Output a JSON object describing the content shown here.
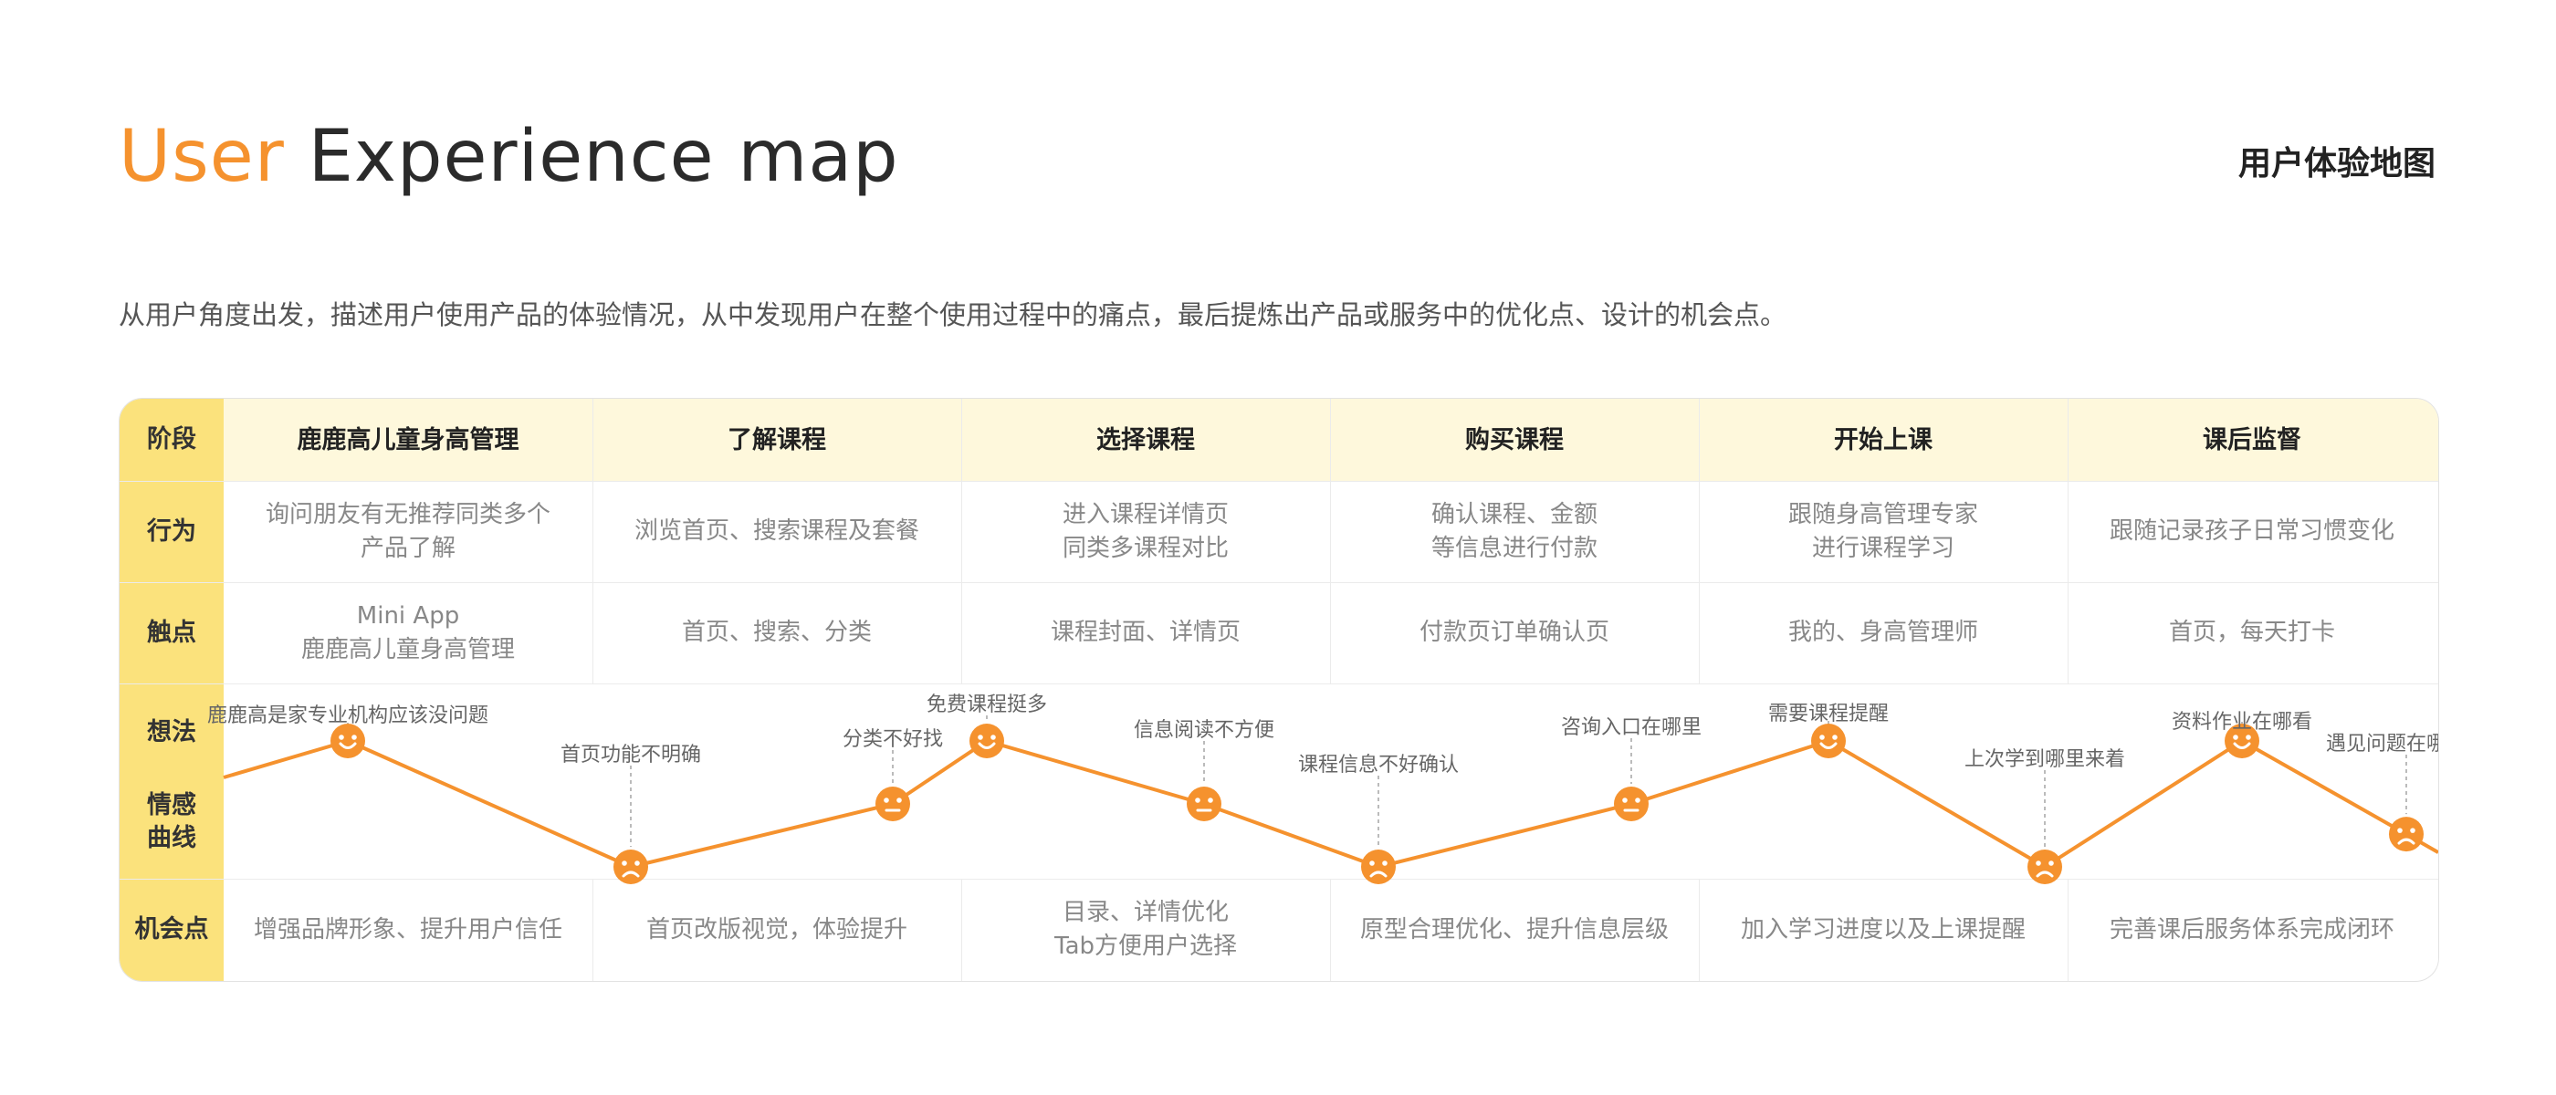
{
  "title": {
    "accent": "User",
    "rest": " Experience map"
  },
  "subtitle_cn": "用户体验地图",
  "description": "从用户角度出发，描述用户使用产品的体验情况，从中发现用户在整个使用过程中的痛点，最后提炼出产品或服务中的优化点、设计的机会点。",
  "row_labels": {
    "stage": "阶段",
    "behavior": "行为",
    "touchpoint": "触点",
    "thought": "想法",
    "emotion": "情感\n曲线",
    "opportunity": "机会点"
  },
  "stages": [
    {
      "name": "鹿鹿高儿童身高管理",
      "behavior": "询问朋友有无推荐同类多个\n产品了解",
      "touchpoint": "Mini App\n鹿鹿高儿童身高管理",
      "opportunity": "增强品牌形象、提升用户信任"
    },
    {
      "name": "了解课程",
      "behavior": "浏览首页、搜索课程及套餐",
      "touchpoint": "首页、搜索、分类",
      "opportunity": "首页改版视觉，体验提升"
    },
    {
      "name": "选择课程",
      "behavior": "进入课程详情页\n同类多课程对比",
      "touchpoint": "课程封面、详情页",
      "opportunity": "目录、详情优化\nTab方便用户选择"
    },
    {
      "name": "购买课程",
      "behavior": "确认课程、金额\n等信息进行付款",
      "touchpoint": "付款页订单确认页",
      "opportunity": "原型合理优化、提升信息层级"
    },
    {
      "name": "开始上课",
      "behavior": "跟随身高管理专家\n进行课程学习",
      "touchpoint": "我的、身高管理师",
      "opportunity": "加入学习进度以及上课提醒"
    },
    {
      "name": "课后监督",
      "behavior": "跟随记录孩子日常习惯变化",
      "touchpoint": "首页，每天打卡",
      "opportunity": "完善课后服务体系完成闭环"
    }
  ],
  "emotion_points": [
    {
      "thought": "鹿鹿高是家专业机构应该没问题",
      "mood": "happy",
      "level": 0.77
    },
    {
      "thought": "首页功能不明确",
      "mood": "sad",
      "level": 0.27
    },
    {
      "thought": "分类不好找",
      "mood": "neutral",
      "level": 0.52
    },
    {
      "thought": "免费课程挺多",
      "mood": "happy",
      "level": 0.77
    },
    {
      "thought": "信息阅读不方便",
      "mood": "neutral",
      "level": 0.52
    },
    {
      "thought": "课程信息不好确认",
      "mood": "sad",
      "level": 0.27
    },
    {
      "thought": "咨询入口在哪里",
      "mood": "neutral",
      "level": 0.52
    },
    {
      "thought": "需要课程提醒",
      "mood": "happy",
      "level": 0.77
    },
    {
      "thought": "上次学到哪里来着",
      "mood": "sad",
      "level": 0.27
    },
    {
      "thought": "资料作业在哪看",
      "mood": "happy",
      "level": 0.77
    },
    {
      "thought": "遇见问题在哪提问",
      "mood": "sad",
      "level": 0.4
    }
  ],
  "colors": {
    "accent": "#F5922E",
    "label_column": "#FBE27C",
    "header_band": "#FEF8DC",
    "curve": "#F5922E"
  }
}
